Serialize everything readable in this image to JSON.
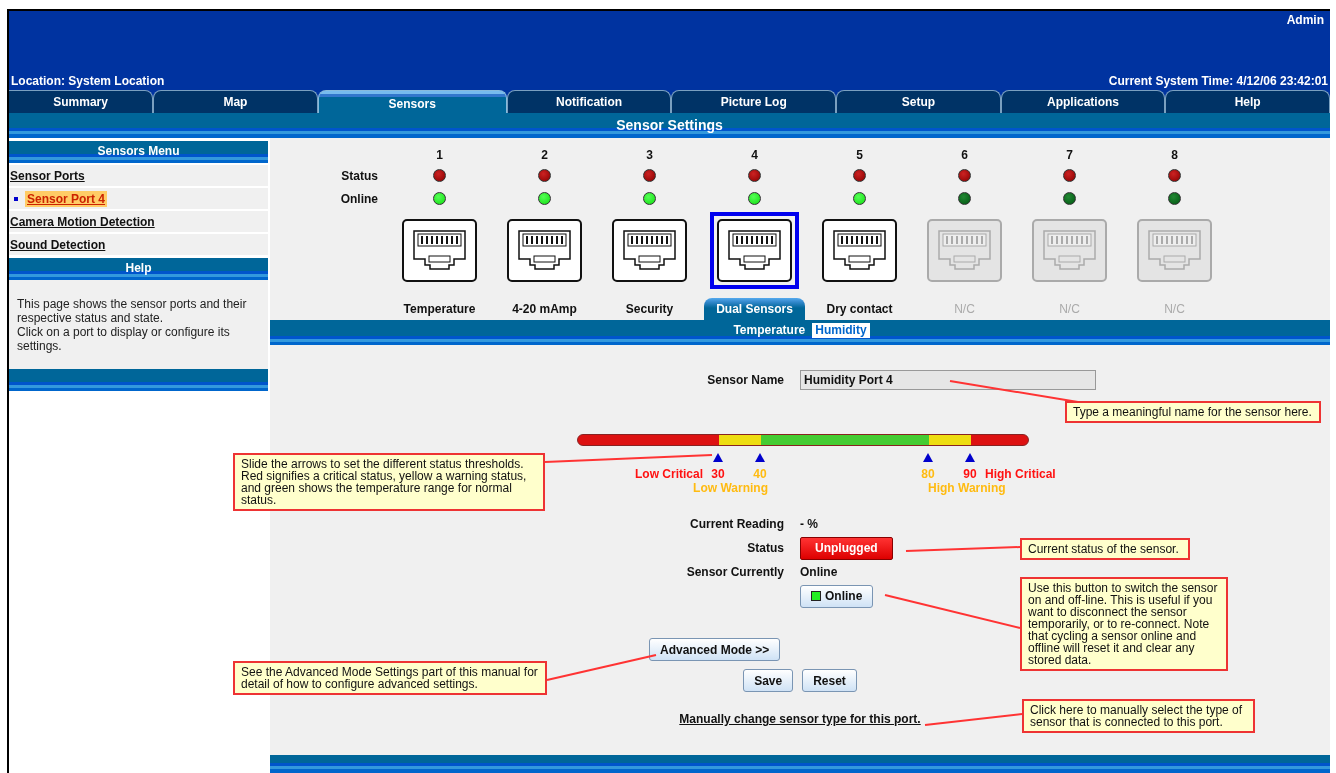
{
  "header": {
    "user": "Admin",
    "location": "Location: System Location",
    "time": "Current System Time: 4/12/06 23:42:01"
  },
  "tabs": [
    {
      "label": "Summary",
      "selected": false
    },
    {
      "label": "Map",
      "selected": false
    },
    {
      "label": "Sensors",
      "selected": true
    },
    {
      "label": "Notification",
      "selected": false
    },
    {
      "label": "Picture Log",
      "selected": false
    },
    {
      "label": "Setup",
      "selected": false
    },
    {
      "label": "Applications",
      "selected": false
    },
    {
      "label": "Help",
      "selected": false
    }
  ],
  "title": "Sensor Settings",
  "sidebar": {
    "menu_title": "Sensors Menu",
    "items": [
      {
        "label": "Sensor Ports",
        "selected": false,
        "children": [
          {
            "label": "Sensor Port 4",
            "selected": true
          }
        ]
      },
      {
        "label": "Camera Motion Detection",
        "selected": false
      },
      {
        "label": "Sound Detection",
        "selected": false
      }
    ],
    "help_title": "Help",
    "help_text": [
      "This page shows the sensor ports and their respective status and state.",
      "Click on a port to display or configure its settings."
    ]
  },
  "ports": {
    "row_labels": [
      "Status",
      "Online"
    ],
    "items": [
      {
        "number": "1",
        "alarm": true,
        "online": true,
        "connected": true,
        "label": "Temperature",
        "selected": false
      },
      {
        "number": "2",
        "alarm": true,
        "online": true,
        "connected": true,
        "label": "4-20 mAmp",
        "selected": false
      },
      {
        "number": "3",
        "alarm": true,
        "online": true,
        "connected": true,
        "label": "Security",
        "selected": false
      },
      {
        "number": "4",
        "alarm": true,
        "online": true,
        "connected": true,
        "label": "Dual Sensors",
        "selected": true
      },
      {
        "number": "5",
        "alarm": true,
        "online": true,
        "connected": true,
        "label": "Dry contact",
        "selected": false
      },
      {
        "number": "6",
        "alarm": true,
        "online": false,
        "connected": false,
        "label": "N/C",
        "selected": false
      },
      {
        "number": "7",
        "alarm": true,
        "online": false,
        "connected": false,
        "label": "N/C",
        "selected": false
      },
      {
        "number": "8",
        "alarm": true,
        "online": false,
        "connected": false,
        "label": "N/C",
        "selected": false
      }
    ]
  },
  "sub_tabs": [
    {
      "label": "Temperature",
      "selected": false
    },
    {
      "label": "Humidity",
      "selected": true
    }
  ],
  "form": {
    "sensor_name": {
      "label": "Sensor Name",
      "value": "Humidity Port 4"
    },
    "thresholds": [
      {
        "kind": "low_critical",
        "value": "30",
        "level": 0.3
      },
      {
        "kind": "low_warning",
        "value": "40",
        "level": 0.4
      },
      {
        "kind": "high_warning",
        "value": "80",
        "level": 0.8
      },
      {
        "kind": "high_critical",
        "value": "90",
        "level": 0.9
      }
    ],
    "threshold_labels": [
      {
        "kind": "low_critical",
        "text": "Low Critical"
      },
      {
        "kind": "low_warning",
        "text": "Low Warning"
      },
      {
        "kind": "high_warning",
        "text": "High Warning"
      },
      {
        "kind": "high_critical",
        "text": "High Critical"
      }
    ],
    "current_reading": {
      "label": "Current Reading",
      "value": "- %"
    },
    "status": {
      "label": "Status",
      "value": "Unplugged",
      "kind": "alarm"
    },
    "sensor_currently": {
      "label": "Sensor Currently",
      "value": "Online"
    },
    "online_button": {
      "label": "Online",
      "on": true
    },
    "advanced_button": "Advanced Mode >>",
    "save_button": "Save",
    "reset_button": "Reset",
    "change_type_link": "Manually change sensor type for this port."
  },
  "callouts": [
    "Type a meaningful name for the sensor here.",
    "Slide the arrows to set the different status thresholds. Red signifies a critical status, yellow a warning status, and green shows the temperature range for normal status.",
    "Current status of the sensor.",
    "Use this button to switch the sensor on and off-line. This is useful if you want to disconnect the sensor temporarily, or to re-connect. Note that cycling a sensor online and offline will reset it and clear any stored data.",
    "See the Advanced Mode Settings part of this manual for detail of how to configure advanced settings.",
    "Click here to manually select the type of sensor that is connected to this port."
  ]
}
